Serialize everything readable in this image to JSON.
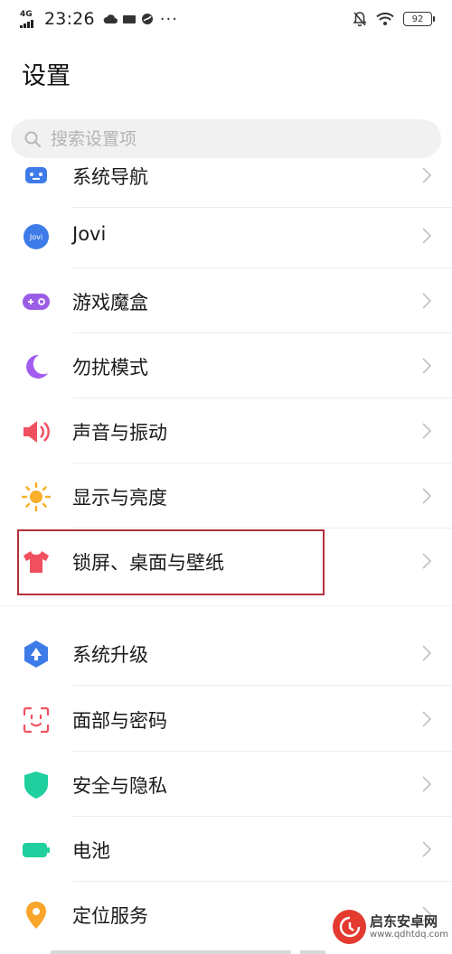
{
  "status_bar": {
    "network": "4G",
    "time": "23:26",
    "more": "···",
    "battery": "92"
  },
  "page": {
    "title": "设置"
  },
  "search": {
    "placeholder": "搜索设置项"
  },
  "settings": [
    {
      "label": "系统导航",
      "icon": "navigation-icon",
      "color": "#3d7be8"
    },
    {
      "label": "Jovi",
      "icon": "jovi-icon",
      "color": "#3d7be8"
    },
    {
      "label": "游戏魔盒",
      "icon": "gamepad-icon",
      "color": "#9b5de5"
    },
    {
      "label": "勿扰模式",
      "icon": "moon-icon",
      "color": "#a35cf0"
    },
    {
      "label": "声音与振动",
      "icon": "speaker-icon",
      "color": "#f05060"
    },
    {
      "label": "显示与亮度",
      "icon": "sun-icon",
      "color": "#f8b02a"
    },
    {
      "label": "锁屏、桌面与壁纸",
      "icon": "tshirt-icon",
      "color": "#f0505f"
    },
    {
      "label": "系统升级",
      "icon": "system-update-icon",
      "color": "#3d7be8"
    },
    {
      "label": "面部与密码",
      "icon": "face-id-icon",
      "color": "#f05060"
    },
    {
      "label": "安全与隐私",
      "icon": "shield-icon",
      "color": "#1fcf9e"
    },
    {
      "label": "电池",
      "icon": "battery-icon",
      "color": "#1fcf9e"
    },
    {
      "label": "定位服务",
      "icon": "location-pin-icon",
      "color": "#f8a52a"
    }
  ],
  "watermark": {
    "name": "启东安卓网",
    "url": "www.qdhtdq.com"
  }
}
